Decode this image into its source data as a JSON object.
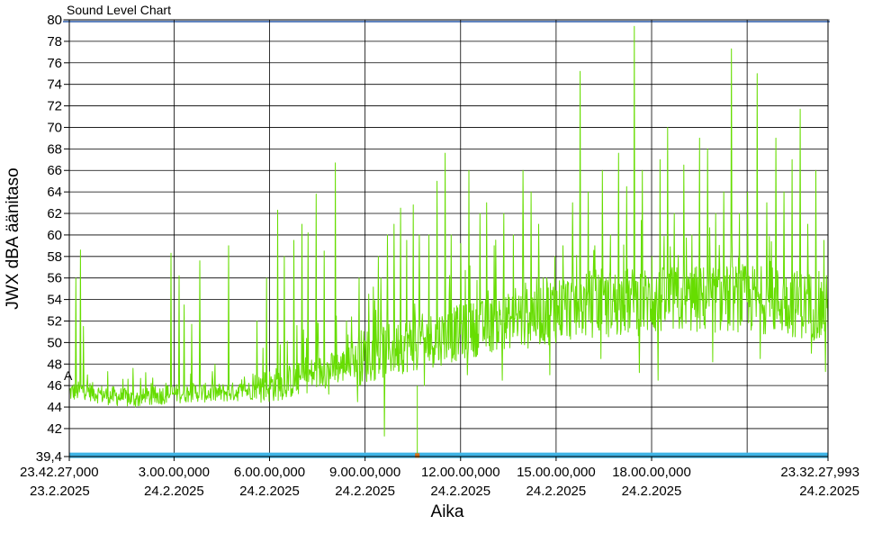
{
  "chart_data": {
    "type": "line",
    "title": "Sound Level Chart",
    "xlabel": "Aika",
    "ylabel": "JWX dBA äänitaso",
    "x_unit": "hours since start",
    "xlim": [
      0,
      23.83
    ],
    "ylim": [
      39.4,
      80
    ],
    "y_ticks": [
      {
        "v": 39.4,
        "label": "39,4"
      },
      {
        "v": 42,
        "label": "42"
      },
      {
        "v": 44,
        "label": "44"
      },
      {
        "v": 46,
        "label": "46"
      },
      {
        "v": 48,
        "label": "48"
      },
      {
        "v": 50,
        "label": "50"
      },
      {
        "v": 52,
        "label": "52"
      },
      {
        "v": 54,
        "label": "54"
      },
      {
        "v": 56,
        "label": "56"
      },
      {
        "v": 58,
        "label": "58"
      },
      {
        "v": 60,
        "label": "60"
      },
      {
        "v": 62,
        "label": "62"
      },
      {
        "v": 64,
        "label": "64"
      },
      {
        "v": 66,
        "label": "66"
      },
      {
        "v": 68,
        "label": "68"
      },
      {
        "v": 70,
        "label": "70"
      },
      {
        "v": 72,
        "label": "72"
      },
      {
        "v": 74,
        "label": "74"
      },
      {
        "v": 76,
        "label": "76"
      },
      {
        "v": 78,
        "label": "78"
      },
      {
        "v": 80,
        "label": "80"
      }
    ],
    "x_ticks": [
      {
        "v": 0,
        "time": "23.42.27,000",
        "date": "23.2.2025",
        "anchor": "start"
      },
      {
        "v": 3.29,
        "time": "3.00.00,000",
        "date": "24.2.2025",
        "anchor": "middle"
      },
      {
        "v": 6.29,
        "time": "6.00.00,000",
        "date": "24.2.2025",
        "anchor": "middle"
      },
      {
        "v": 9.29,
        "time": "9.00.00,000",
        "date": "24.2.2025",
        "anchor": "middle"
      },
      {
        "v": 12.29,
        "time": "12.00.00,000",
        "date": "24.2.2025",
        "anchor": "middle"
      },
      {
        "v": 15.29,
        "time": "15.00.00,000",
        "date": "24.2.2025",
        "anchor": "middle"
      },
      {
        "v": 18.29,
        "time": "18.00.00,000",
        "date": "24.2.2025",
        "anchor": "middle"
      },
      {
        "v": 23.83,
        "time": "23.32.27,993",
        "date": "24.2.2025",
        "anchor": "end"
      }
    ],
    "x_gridlines": [
      0,
      3.29,
      6.29,
      9.29,
      12.29,
      15.29,
      18.29,
      21.29,
      23.83
    ],
    "grid": true,
    "cursor_label": "A",
    "threshold_band": {
      "value": 39.6,
      "color": "#3fb4e6"
    },
    "marker": {
      "x": 10.93,
      "y": 39.5,
      "color": "#d9731a"
    },
    "series": [
      {
        "color": "#66dd00",
        "baseline": [
          [
            0,
            45.2
          ],
          [
            0.5,
            45.4
          ],
          [
            1,
            45.0
          ],
          [
            1.5,
            44.8
          ],
          [
            2,
            44.6
          ],
          [
            2.5,
            44.7
          ],
          [
            3,
            45.0
          ],
          [
            3.5,
            45.1
          ],
          [
            4,
            45.2
          ],
          [
            4.5,
            45.1
          ],
          [
            5,
            45.2
          ],
          [
            5.5,
            45.3
          ],
          [
            6,
            45.5
          ],
          [
            6.5,
            45.8
          ],
          [
            7,
            46.1
          ],
          [
            7.5,
            46.6
          ],
          [
            8,
            47.0
          ],
          [
            8.5,
            47.4
          ],
          [
            9,
            48.0
          ],
          [
            9.5,
            48.4
          ],
          [
            10,
            48.8
          ],
          [
            10.5,
            49.2
          ],
          [
            11,
            49.5
          ],
          [
            11.5,
            49.8
          ],
          [
            12,
            50.2
          ],
          [
            12.5,
            50.6
          ],
          [
            13,
            50.9
          ],
          [
            13.5,
            51.3
          ],
          [
            14,
            51.6
          ],
          [
            14.5,
            52.0
          ],
          [
            15,
            52.3
          ],
          [
            15.5,
            52.6
          ],
          [
            16,
            52.8
          ],
          [
            16.5,
            53.0
          ],
          [
            17,
            53.0
          ],
          [
            17.5,
            53.1
          ],
          [
            18,
            53.2
          ],
          [
            18.5,
            53.2
          ],
          [
            19,
            53.3
          ],
          [
            19.5,
            53.3
          ],
          [
            20,
            53.4
          ],
          [
            20.5,
            53.4
          ],
          [
            21,
            53.5
          ],
          [
            21.5,
            53.4
          ],
          [
            22,
            53.3
          ],
          [
            22.5,
            53.1
          ],
          [
            23,
            52.9
          ],
          [
            23.5,
            52.7
          ],
          [
            23.83,
            52.5
          ]
        ],
        "spikes": [
          [
            0.2,
            56.0
          ],
          [
            0.35,
            58.6
          ],
          [
            0.45,
            51.5
          ],
          [
            1.2,
            47.3
          ],
          [
            2.0,
            47.6
          ],
          [
            2.4,
            47.2
          ],
          [
            3.2,
            58.3
          ],
          [
            3.45,
            56.2
          ],
          [
            3.6,
            53.5
          ],
          [
            3.85,
            51.7
          ],
          [
            4.1,
            57.6
          ],
          [
            4.5,
            47.3
          ],
          [
            5.0,
            59.0
          ],
          [
            5.5,
            46.8
          ],
          [
            5.9,
            52.0
          ],
          [
            6.2,
            56.0
          ],
          [
            6.55,
            62.3
          ],
          [
            6.75,
            58.0
          ],
          [
            7.05,
            59.5
          ],
          [
            7.3,
            61.0
          ],
          [
            7.5,
            60.2
          ],
          [
            7.75,
            63.8
          ],
          [
            8.0,
            58.5
          ],
          [
            8.35,
            66.7
          ],
          [
            8.7,
            52.0
          ],
          [
            9.1,
            56.0
          ],
          [
            9.4,
            54.5
          ],
          [
            9.7,
            58.0
          ],
          [
            10.0,
            60.0
          ],
          [
            10.2,
            61.0
          ],
          [
            10.4,
            62.5
          ],
          [
            10.6,
            59.5
          ],
          [
            10.8,
            62.8
          ],
          [
            11.0,
            60.0
          ],
          [
            11.3,
            60.0
          ],
          [
            11.55,
            65.0
          ],
          [
            11.8,
            67.6
          ],
          [
            12.0,
            60.0
          ],
          [
            12.3,
            59.2
          ],
          [
            12.55,
            66.0
          ],
          [
            12.9,
            62.0
          ],
          [
            13.1,
            63.0
          ],
          [
            13.35,
            59.0
          ],
          [
            13.65,
            62.0
          ],
          [
            13.95,
            60.0
          ],
          [
            14.25,
            66.0
          ],
          [
            14.5,
            64.0
          ],
          [
            14.75,
            61.0
          ],
          [
            15.0,
            56.0
          ],
          [
            15.25,
            58.0
          ],
          [
            15.5,
            59.0
          ],
          [
            15.8,
            63.0
          ],
          [
            16.05,
            75.2
          ],
          [
            16.3,
            64.0
          ],
          [
            16.5,
            59.0
          ],
          [
            16.75,
            66.0
          ],
          [
            17.0,
            60.0
          ],
          [
            17.25,
            67.6
          ],
          [
            17.5,
            64.5
          ],
          [
            17.75,
            79.4
          ],
          [
            18.0,
            66.0
          ],
          [
            18.3,
            58.0
          ],
          [
            18.55,
            67.0
          ],
          [
            18.8,
            70.0
          ],
          [
            19.0,
            62.0
          ],
          [
            19.3,
            66.5
          ],
          [
            19.55,
            60.0
          ],
          [
            19.8,
            69.0
          ],
          [
            20.05,
            68.0
          ],
          [
            20.3,
            62.0
          ],
          [
            20.55,
            64.0
          ],
          [
            20.8,
            77.3
          ],
          [
            21.05,
            62.0
          ],
          [
            21.3,
            64.0
          ],
          [
            21.6,
            75.0
          ],
          [
            21.9,
            63.0
          ],
          [
            22.2,
            69.0
          ],
          [
            22.45,
            64.0
          ],
          [
            22.7,
            67.0
          ],
          [
            22.95,
            71.7
          ],
          [
            23.2,
            61.0
          ],
          [
            23.45,
            66.0
          ],
          [
            23.7,
            59.5
          ]
        ],
        "dips": [
          [
            8.15,
            45.2
          ],
          [
            9.05,
            44.5
          ],
          [
            9.9,
            41.3
          ],
          [
            11.15,
            46.0
          ],
          [
            12.5,
            47.0
          ],
          [
            13.6,
            46.5
          ],
          [
            15.1,
            47.0
          ],
          [
            16.7,
            48.5
          ],
          [
            17.9,
            47.2
          ],
          [
            18.5,
            46.5
          ],
          [
            20.2,
            48.2
          ],
          [
            21.7,
            48.5
          ],
          [
            23.3,
            49.0
          ],
          [
            23.75,
            47.3
          ]
        ]
      }
    ]
  }
}
